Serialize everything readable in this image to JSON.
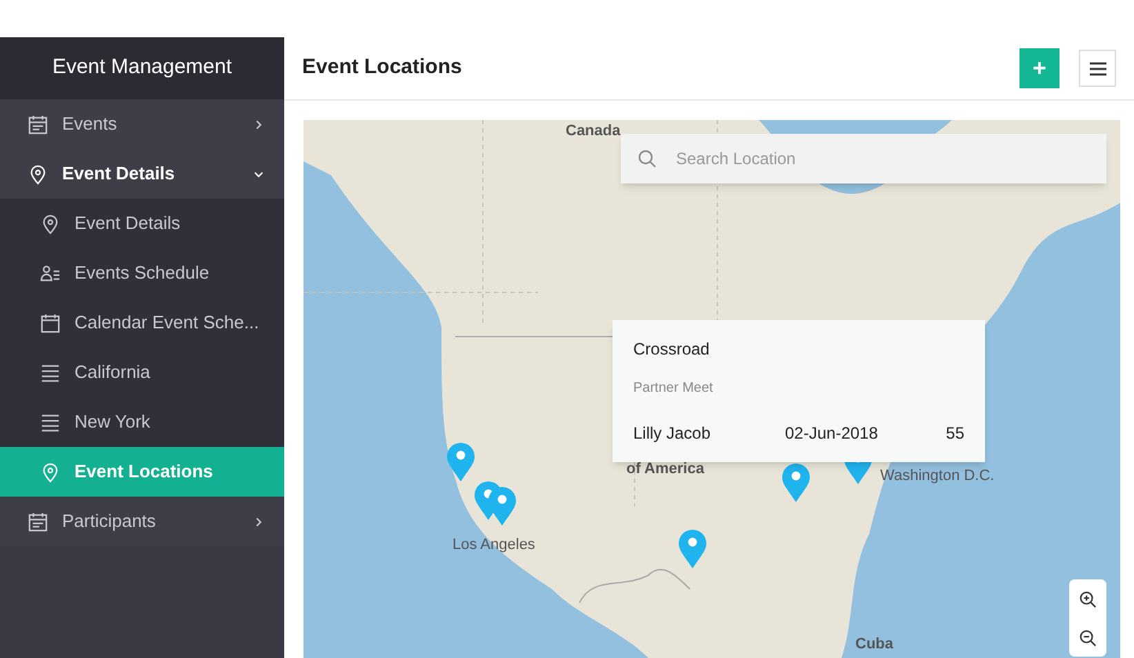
{
  "sidebar": {
    "title": "Event Management",
    "items": [
      {
        "label": "Events",
        "expanded": false,
        "selected": false
      },
      {
        "label": "Event Details",
        "expanded": true,
        "selected": false,
        "children": [
          {
            "label": "Event Details",
            "selected": false
          },
          {
            "label": "Events Schedule",
            "selected": false
          },
          {
            "label": "Calendar Event Sche...",
            "selected": false
          },
          {
            "label": "California",
            "selected": false
          },
          {
            "label": "New York",
            "selected": false
          },
          {
            "label": "Event Locations",
            "selected": true
          }
        ]
      },
      {
        "label": "Participants",
        "expanded": false,
        "selected": false
      }
    ]
  },
  "header": {
    "title": "Event Locations",
    "add_button": "+"
  },
  "map": {
    "search": {
      "placeholder": "Search Location"
    },
    "labels": [
      "Canada",
      "of America",
      "Los Angeles",
      "Washington D.C.",
      "Cuba"
    ],
    "popup": {
      "title": "Crossroad",
      "subtitle": "Partner Meet",
      "name": "Lilly Jacob",
      "date": "02-Jun-2018",
      "count": "55"
    }
  }
}
